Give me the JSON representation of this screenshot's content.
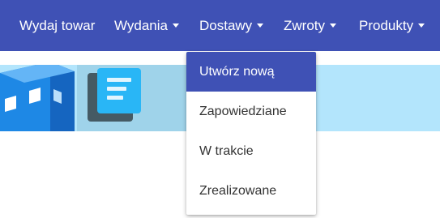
{
  "navbar": {
    "items": [
      {
        "label": "Wydaj towar",
        "has_caret": false
      },
      {
        "label": "Wydania",
        "has_caret": true
      },
      {
        "label": "Dostawy",
        "has_caret": true
      },
      {
        "label": "Zwroty",
        "has_caret": true
      },
      {
        "label": "Produkty",
        "has_caret": true
      }
    ]
  },
  "dropdown": {
    "items": [
      {
        "label": "Utwórz nową",
        "active": true
      },
      {
        "label": "Zapowiedziane",
        "active": false
      },
      {
        "label": "W trakcie",
        "active": false
      },
      {
        "label": "Zrealizowane",
        "active": false
      }
    ]
  },
  "colors": {
    "navbar_bg": "#3f51b5",
    "nav_text": "#ffffff",
    "banner_bg": "#b3e5fc",
    "dropdown_active_bg": "#3f51b5",
    "dropdown_text": "#333333"
  },
  "icons": {
    "building": "building-icon",
    "document": "document-icon",
    "caret": "caret-down-icon"
  }
}
